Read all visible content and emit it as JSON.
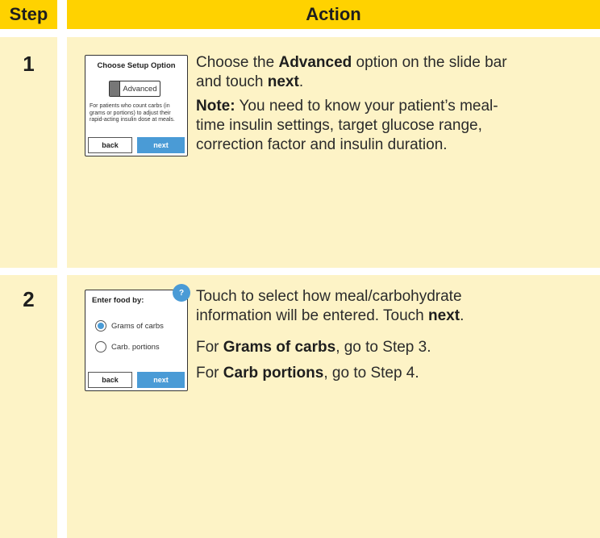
{
  "header": {
    "step": "Step",
    "action": "Action"
  },
  "rows": [
    {
      "step": "1",
      "device": {
        "title": "Choose Setup Option",
        "slide_label": "Advanced",
        "description": "For patients who count carbs (in grams or portions) to adjust their rapid-acting insulin dose at meals.",
        "back": "back",
        "next": "next"
      },
      "text": {
        "p1_a": "Choose the ",
        "p1_b": "Advanced",
        "p1_c": " option on the slide bar",
        "p1_d": "and touch ",
        "p1_e": "next",
        "p1_f": ".",
        "note_label": "Note:",
        "note_l1": " You need to know your patient’s meal-",
        "note_l2": "time insulin settings, target glucose range,",
        "note_l3": "correction factor and insulin duration."
      }
    },
    {
      "step": "2",
      "device": {
        "title": "Enter food by:",
        "help": "?",
        "option1": "Grams of carbs",
        "option2": "Carb. portions",
        "back": "back",
        "next": "next"
      },
      "text": {
        "p1_l1": "Touch to select how meal/carbohydrate",
        "p1_l2a": "information will be entered. Touch ",
        "p1_l2b": "next",
        "p1_l2c": ".",
        "p2_a": "For ",
        "p2_b": "Grams of carbs",
        "p2_c": ", go to Step 3.",
        "p3_a": "For ",
        "p3_b": "Carb portions",
        "p3_c": ", go to Step 4."
      }
    }
  ],
  "colors": {
    "header": "#ffd200",
    "cell": "#fdf3c6",
    "button": "#4a9bd6"
  }
}
